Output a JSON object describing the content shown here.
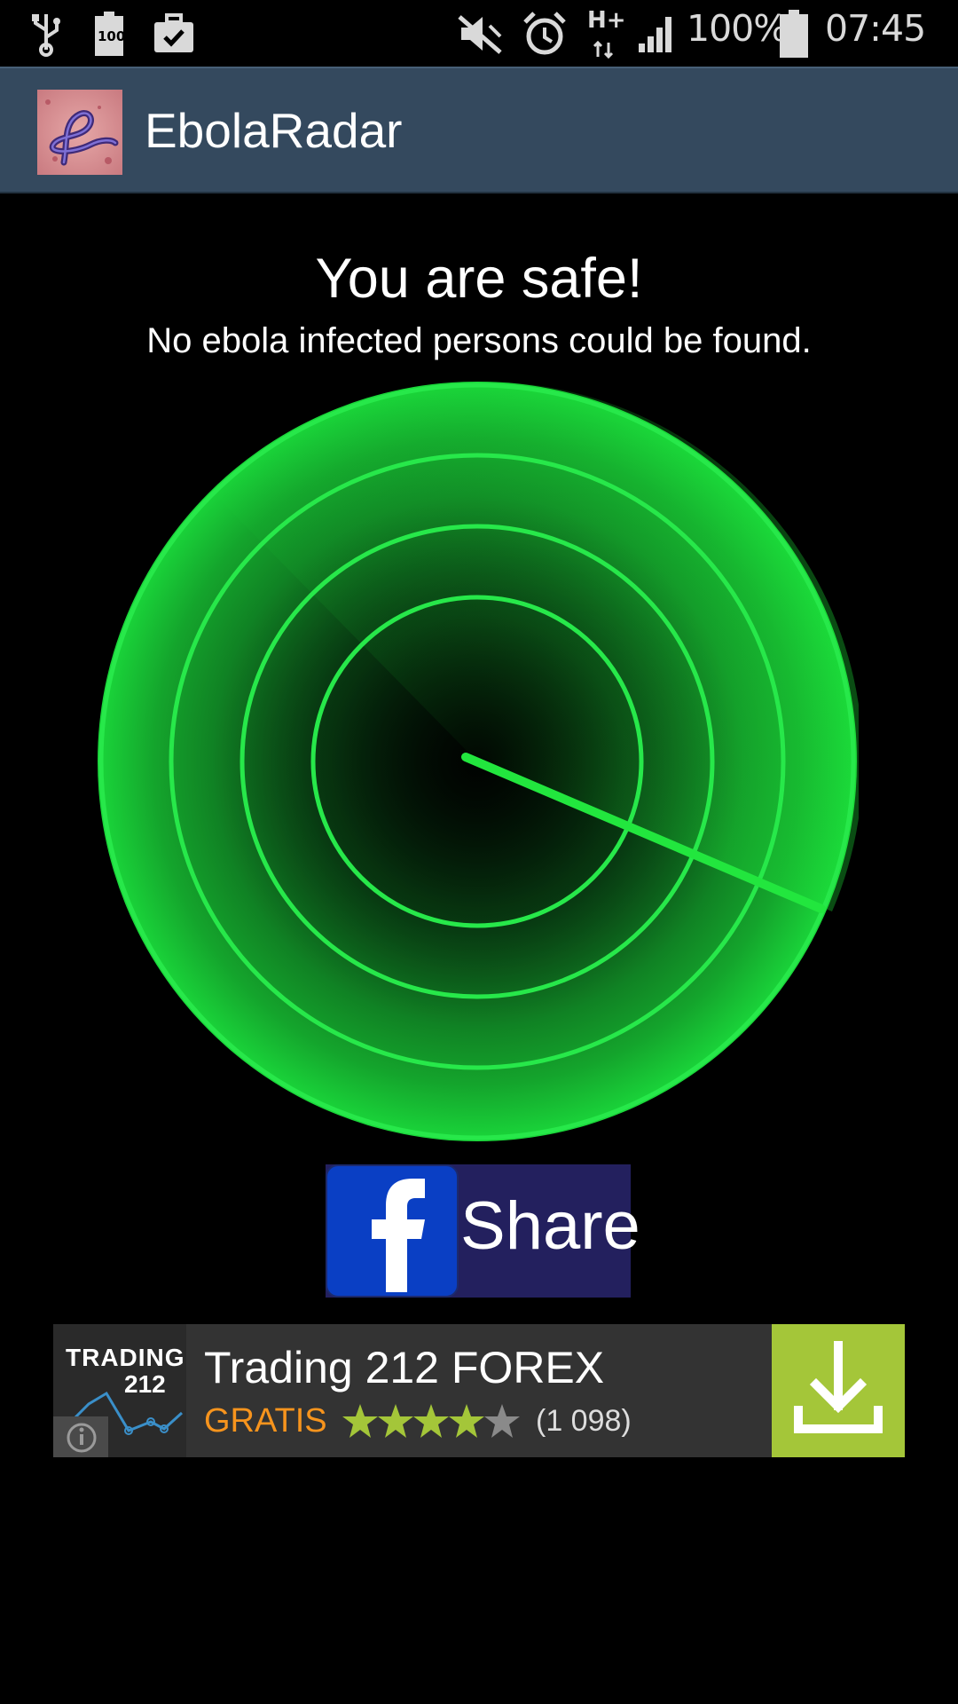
{
  "status_bar": {
    "battery_small_label": "100",
    "battery_percent": "100%",
    "time": "07:45",
    "network": "H+",
    "icons": [
      "usb-icon",
      "battery-full-icon",
      "briefcase-check-icon",
      "mute-icon",
      "alarm-icon",
      "network-hplus-icon",
      "signal-icon",
      "battery-icon"
    ]
  },
  "app_bar": {
    "title": "EbolaRadar",
    "icon": "ebola-virus-icon"
  },
  "main": {
    "headline": "You are safe!",
    "subline": "No ebola infected persons could be found.",
    "radar": {
      "color": "#1ee83a",
      "sweep_angle_deg": 24,
      "rings": 4
    }
  },
  "share_button": {
    "label": "Share",
    "icon": "facebook-icon",
    "colors": {
      "background": "#23205e",
      "fb_blue": "#0a3fc4"
    }
  },
  "ad_banner": {
    "logo_line1": "TRADING",
    "logo_line2": "212",
    "title": "Trading 212 FOREX",
    "price": "GRATIS",
    "rating": 4,
    "rating_max": 5,
    "review_count": "(1 098)",
    "colors": {
      "price": "#f7941d",
      "download_bg": "#a4c639",
      "star": "#a4c639"
    }
  }
}
